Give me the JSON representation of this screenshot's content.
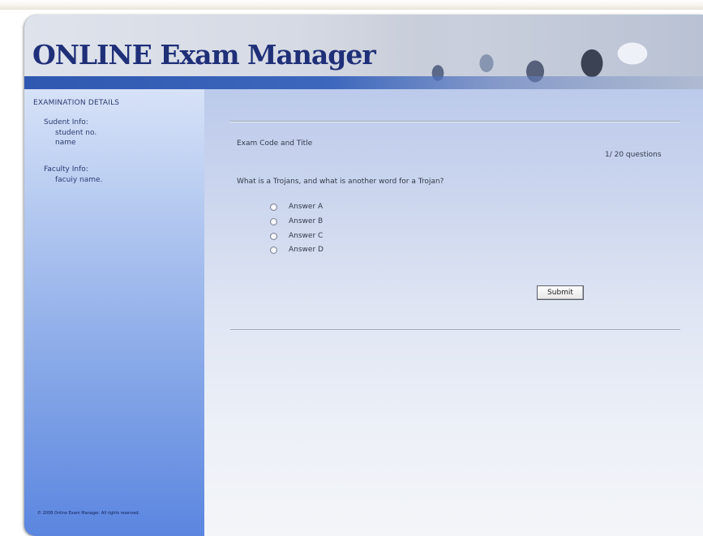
{
  "header": {
    "logo_text": "ONLINE Exam Manager"
  },
  "sidebar": {
    "title": "EXAMINATION DETAILS",
    "student_info_label": "Sudent Info:",
    "student_no": "student no.",
    "student_name": "name",
    "faculty_info_label": "Faculty Info:",
    "faculty_name": "facuiy name.",
    "copyright": "© 2008 Online Exam Manager. All rights reserved."
  },
  "exam": {
    "code_title": "Exam Code and Title",
    "progress": "1/ 20 questions",
    "question": "What is a Trojans, and what is another word for a Trojan?",
    "answers": [
      "Answer A",
      "Answer B",
      "Answer C",
      "Answer D"
    ],
    "submit_label": "Submit"
  }
}
